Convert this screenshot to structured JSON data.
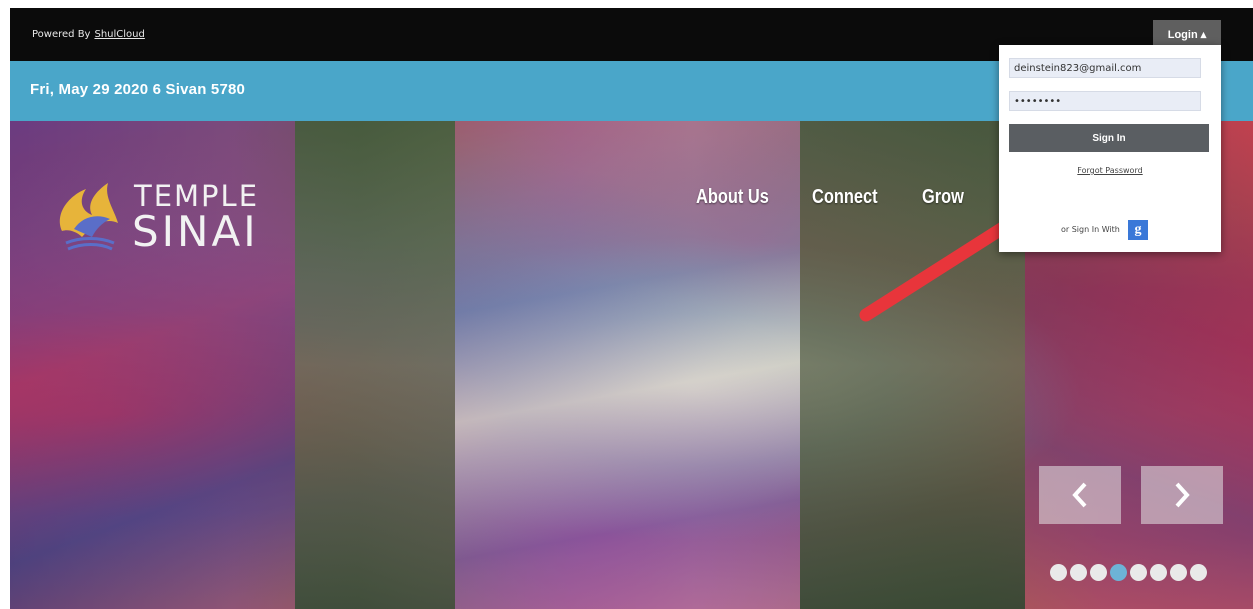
{
  "topbar": {
    "powered_by": "Powered By",
    "powered_link": "ShulCloud",
    "login_label": "Login ▴"
  },
  "datebar": {
    "date": "Fri, May 29 2020 6 Sivan 5780"
  },
  "logo": {
    "line1": "TEMPLE",
    "line2": "SINAI"
  },
  "nav": {
    "items": [
      "About Us",
      "Connect",
      "Grow"
    ]
  },
  "login_dropdown": {
    "email_value": "deinstein823@gmail.com",
    "password_value": "••••••••",
    "sign_in_label": "Sign In",
    "forgot_label": "Forgot Password",
    "alt_signin_label": "or Sign In With",
    "google_letter": "g"
  },
  "carousel": {
    "prev_icon": "chevron-left-icon",
    "next_icon": "chevron-right-icon",
    "dot_count": 8,
    "active_dot": 4
  },
  "colors": {
    "topbar": "#0b0b0b",
    "datebar": "#4aa6c9",
    "annotation_arrow": "#e8353b",
    "google_button": "#3a78d8"
  }
}
